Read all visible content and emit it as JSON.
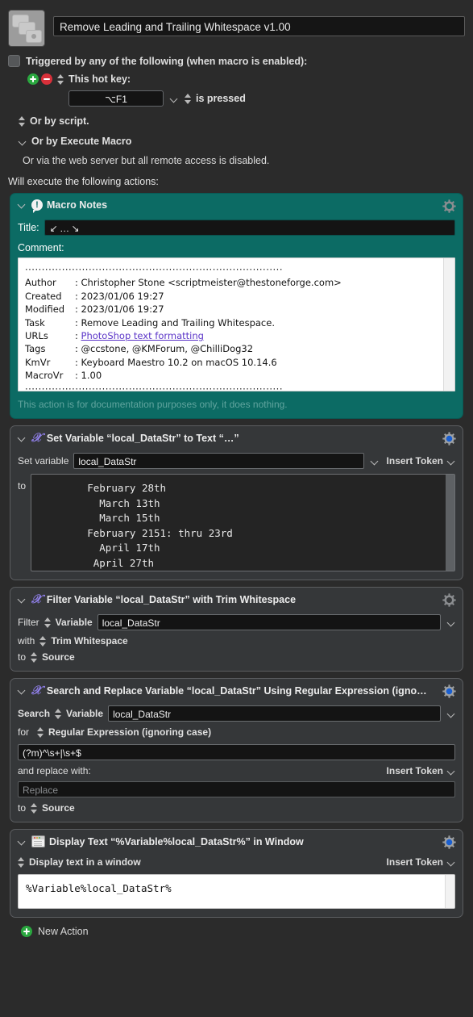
{
  "window": {
    "macro_icon": "macro-stack-icon",
    "macro_title": "Remove Leading and Trailing Whitespace v1.00"
  },
  "trigger": {
    "checkbox_label": "Triggered by any of the following (when macro is enabled):",
    "add_icon": "add-trigger-icon",
    "remove_icon": "remove-trigger-icon",
    "hotkey_label": "This hot key:",
    "hotkey_value": "⌥F1",
    "is_pressed_label": "is pressed",
    "or_by_script": "Or by script.",
    "or_by_execute_macro": "Or by Execute Macro",
    "web_server_note": "Or via the web server but all remote access is disabled.",
    "will_execute_label": "Will execute the following actions:"
  },
  "colors": {
    "teal_card": "#0c6b64",
    "dark_card": "#353739",
    "blue_gear": "#1a5fd0",
    "gray_gear": "#8b8d90",
    "purple_x": "#8f7fe8",
    "green_badge": "#2aa73f",
    "red_badge": "#d8303a",
    "link": "#5b35c8"
  },
  "actions": [
    {
      "id": "macro-notes",
      "icon": "exclamation-bubble-icon",
      "title": "Macro Notes",
      "gear": "gear-icon-gray",
      "title_label": "Title:",
      "title_value": "↙ … ↘",
      "comment_label": "Comment:",
      "comment_divider": "·············································································",
      "comment_rows": [
        {
          "key": "Author",
          "value": "Christopher Stone <scriptmeister@thestoneforge.com>"
        },
        {
          "key": "Created",
          "value": "2023/01/06 19:27"
        },
        {
          "key": "Modified",
          "value": "2023/01/06 19:27"
        },
        {
          "key": "Task",
          "value": "Remove Leading and Trailing Whitespace."
        },
        {
          "key": "URLs",
          "value": "PhotoShop text formatting",
          "link": true
        },
        {
          "key": "Tags",
          "value": "@ccstone, @KMForum, @ChilliDog32"
        },
        {
          "key": "KmVr",
          "value": "Keyboard Maestro 10.2 on macOS 10.14.6"
        },
        {
          "key": "MacroVr",
          "value": "1.00"
        }
      ],
      "footer": "This action is for documentation purposes only, it does nothing."
    },
    {
      "id": "set-variable",
      "icon": "script-x-icon",
      "title": "Set Variable “local_DataStr” to Text “…”",
      "gear": "gear-icon-blue",
      "set_variable_label": "Set variable",
      "variable_name": "local_DataStr",
      "insert_token_label": "Insert Token",
      "to_label": "to",
      "text_value": "        February 28th\n          March 13th\n          March 15th\n        February 2151: thru 23rd\n          April 17th\n         April 27th"
    },
    {
      "id": "filter-variable",
      "icon": "script-x-icon",
      "title": "Filter Variable “local_DataStr” with Trim Whitespace",
      "gear": "gear-icon-gray",
      "filter_label": "Filter",
      "source_kind": "Variable",
      "variable_name": "local_DataStr",
      "with_label": "with",
      "filter_kind": "Trim Whitespace",
      "to_label": "to",
      "destination": "Source"
    },
    {
      "id": "search-replace",
      "icon": "script-x-icon",
      "title": "Search and Replace Variable “local_DataStr” Using Regular Expression (igno…",
      "gear": "gear-icon-blue",
      "search_label": "Search",
      "source_kind": "Variable",
      "variable_name": "local_DataStr",
      "for_label": "for",
      "match_kind": "Regular Expression (ignoring case)",
      "search_pattern": "(?m)^\\s+|\\s+$",
      "replace_label": "and replace with:",
      "insert_token_label": "Insert Token",
      "replace_placeholder": "Replace",
      "replace_value": "",
      "to_label": "to",
      "destination": "Source"
    },
    {
      "id": "display-text",
      "icon": "window-icon",
      "title": "Display Text “%Variable%local_DataStr%” in Window",
      "gear": "gear-icon-blue",
      "display_mode": "Display text in a window",
      "insert_token_label": "Insert Token",
      "text_value": "%Variable%local_DataStr%"
    }
  ],
  "footer": {
    "new_action_label": "New Action",
    "new_action_icon": "add-action-icon"
  }
}
